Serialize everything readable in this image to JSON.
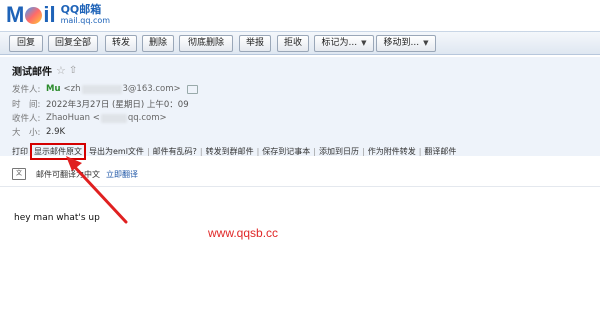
{
  "logo": {
    "brand": "M",
    "brand_tail": "il",
    "cn": "QQ邮箱",
    "url": "mail.qq.com"
  },
  "toolbar": {
    "reply": "回复",
    "reply_all": "回复全部",
    "forward": "转发",
    "delete": "删除",
    "delete_permanent": "彻底删除",
    "report": "举报",
    "reject": "拒收",
    "mark_as": "标记为...",
    "move_to": "移动到..."
  },
  "mail": {
    "subject": "测试邮件",
    "sender_label": "发件人:",
    "sender_name": "Mu",
    "sender_email_prefix": "<zh",
    "sender_email_suffix": "3@163.com>",
    "time_label": "时　间:",
    "time_value": "2022年3月27日 (星期日) 上午0：09",
    "to_label": "收件人:",
    "to_name": "ZhaoHuan <",
    "to_email_suffix": "qq.com>",
    "size_label": "大　小:",
    "size_value": "2.9K",
    "body": "hey man what's up"
  },
  "actions": {
    "print": "打印",
    "show_original": "显示邮件原文",
    "export_eml": "导出为eml文件",
    "garbled": "邮件有乱码?",
    "forward_group": "转发到群邮件",
    "save_note": "保存到记事本",
    "add_calendar": "添加到日历",
    "forward_attachment": "作为附件转发",
    "translate": "翻译邮件"
  },
  "translate_bar": {
    "text": "邮件可翻译为中文",
    "link": "立即翻译"
  },
  "watermark": "www.qqsb.cc",
  "colors": {
    "brand_blue": "#1e63b8",
    "highlight_red": "#d40000",
    "watermark_red": "#e02828"
  }
}
